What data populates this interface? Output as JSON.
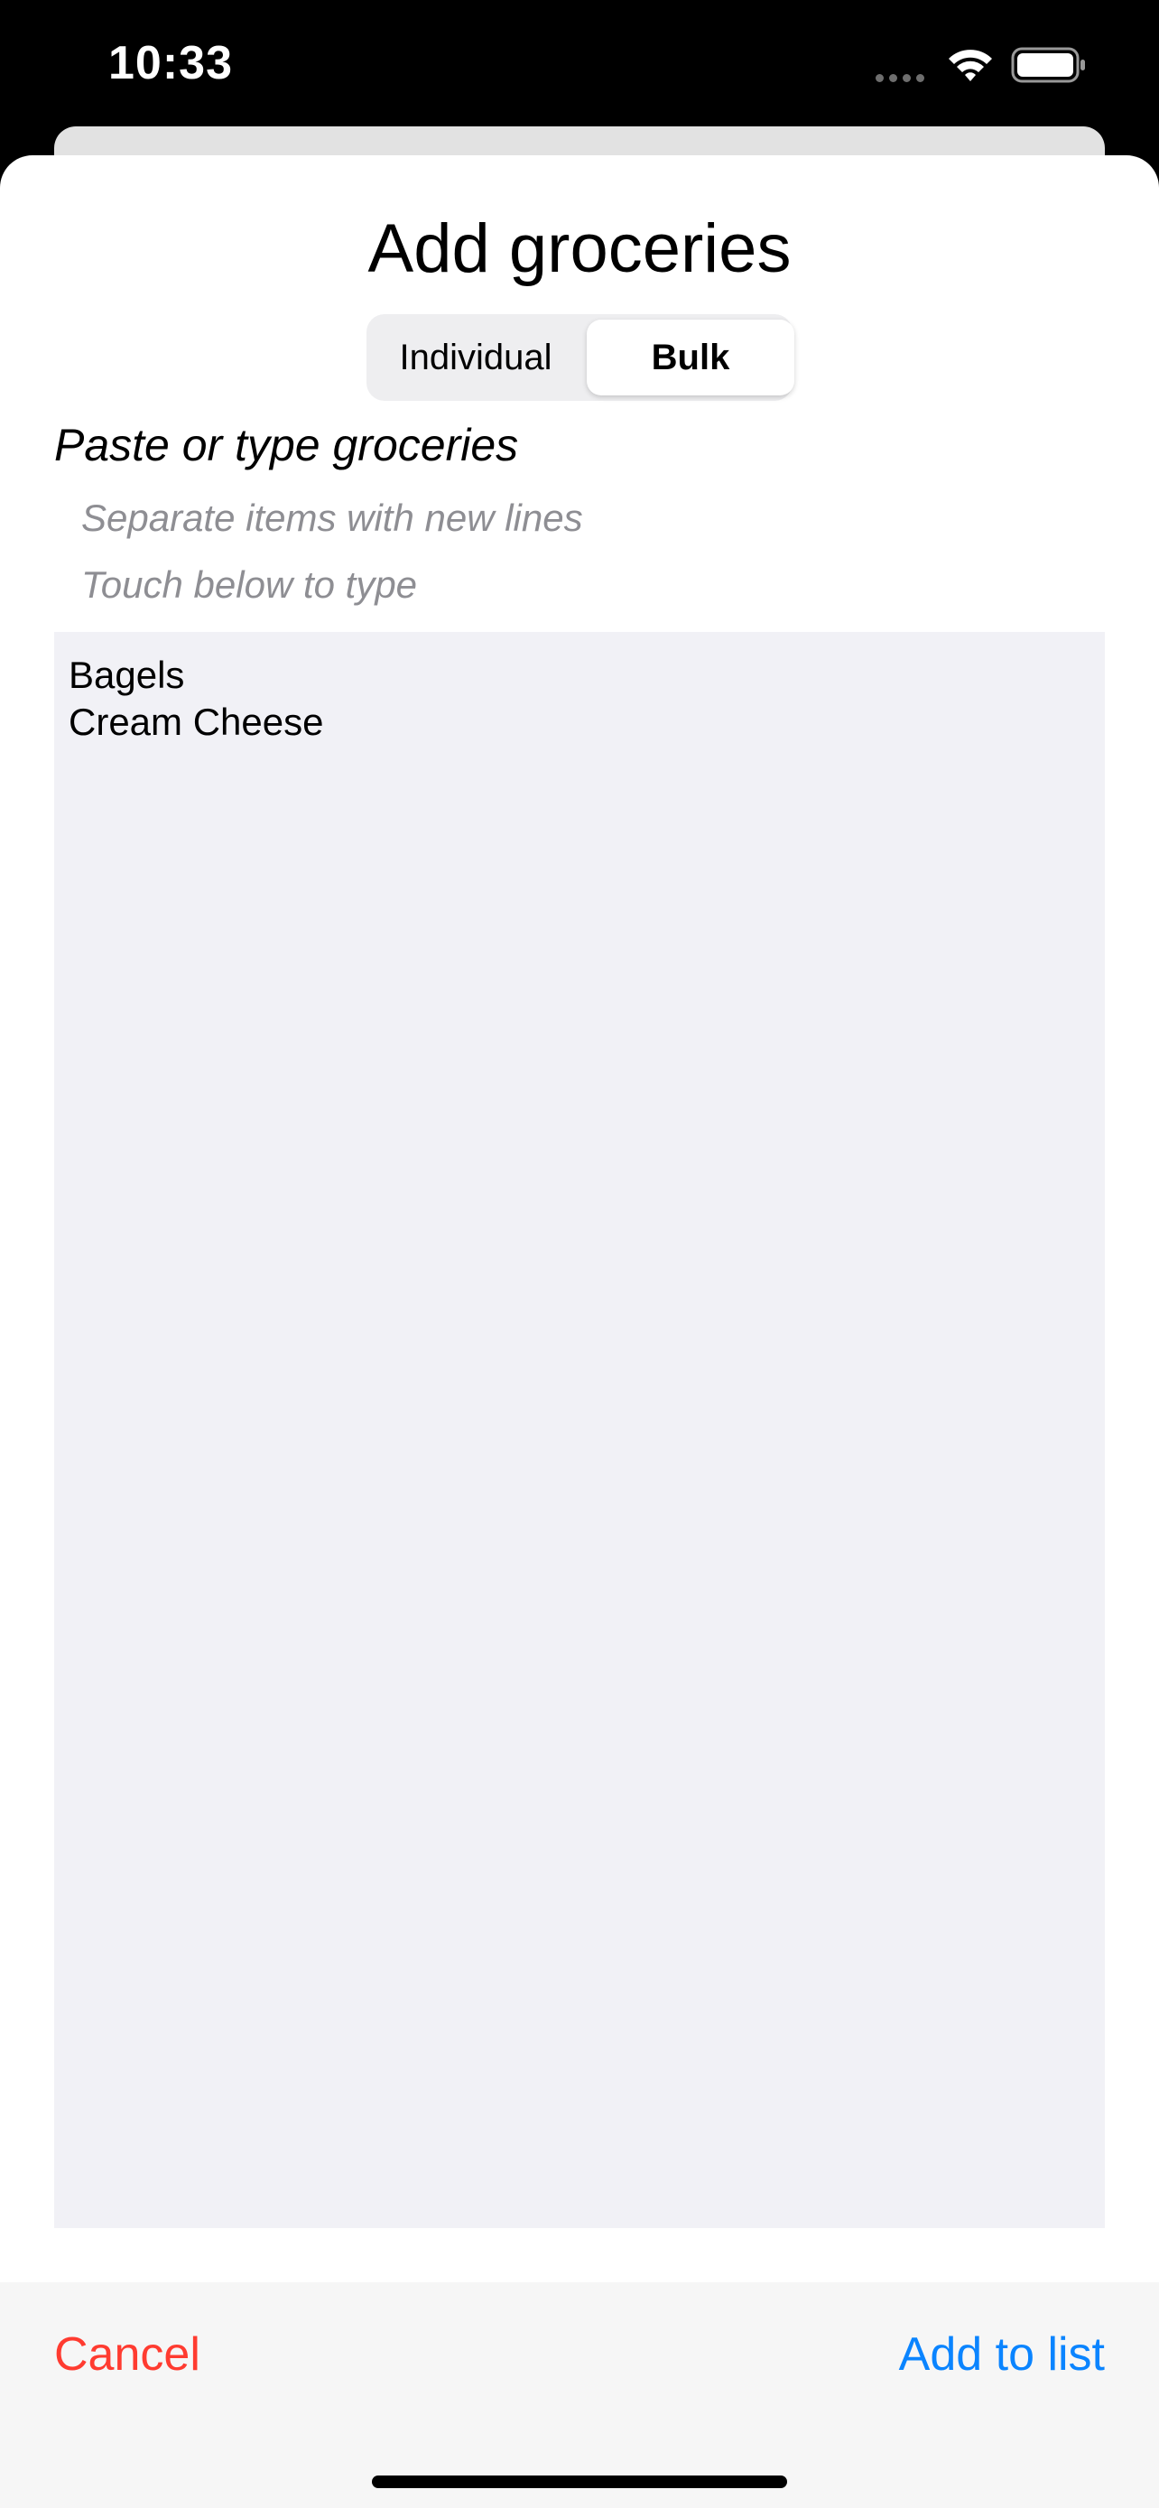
{
  "status_bar": {
    "time": "10:33",
    "icons": [
      "signal-icon",
      "wifi-icon",
      "battery-icon"
    ]
  },
  "sheet": {
    "title": "Add groceries",
    "segmented_control": {
      "options": [
        "Individual",
        "Bulk"
      ],
      "selected": "Bulk"
    },
    "section_title": "Paste or type groceries",
    "hints": [
      "Separate items with new lines",
      "Touch below to type"
    ],
    "text_area": {
      "lines": [
        "Bagels",
        "Cream Cheese"
      ]
    }
  },
  "footer": {
    "cancel_label": "Cancel",
    "add_label": "Add to list"
  },
  "colors": {
    "cancel": "#ff3b30",
    "accent": "#0a84ff",
    "text_area_bg": "#f1f1f6",
    "hint": "#8e8e93"
  }
}
